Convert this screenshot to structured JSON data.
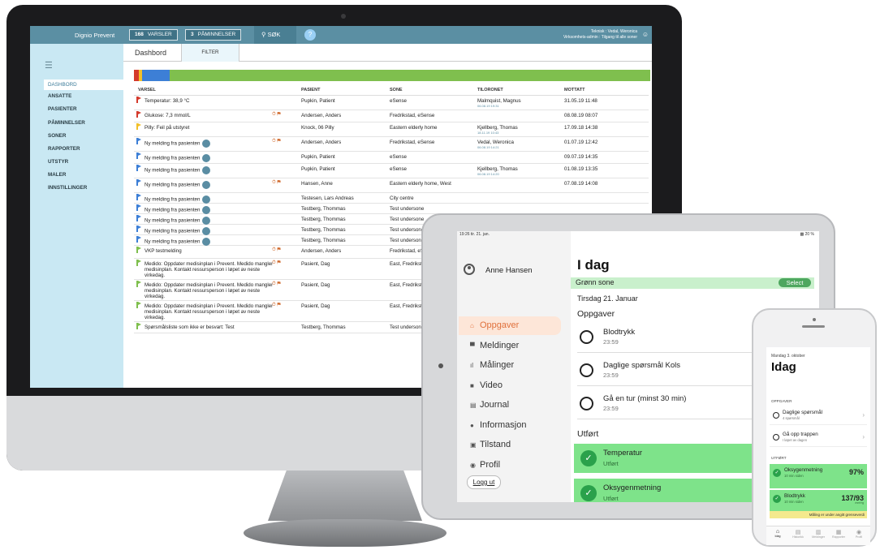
{
  "desktop": {
    "brand": "Dignio Prevent",
    "alerts_count": "168",
    "alerts_label": "VARSLER",
    "reminders_count": "3",
    "reminders_label": "PÅMINNELSER",
    "search_label": "SØK",
    "help_label": "?",
    "user_line1": "Teknisk : Vedal, Weronica",
    "user_line2": "Virksomhets-admin : Tilgang til alle soner",
    "tab_title": "Dashbord",
    "tab_filter": "FILTER",
    "sidebar": [
      {
        "label": "DASHBORD"
      },
      {
        "label": "ANSATTE"
      },
      {
        "label": "PASIENTER"
      },
      {
        "label": "PÅMINNELSER"
      },
      {
        "label": "SONER"
      },
      {
        "label": "RAPPORTER"
      },
      {
        "label": "UTSTYR"
      },
      {
        "label": "MALER"
      },
      {
        "label": "INNSTILLINGER"
      }
    ],
    "columns": [
      "VARSEL",
      "PASIENT",
      "SONE",
      "TILORONET",
      "MOTTATT"
    ],
    "rows": [
      {
        "varsel": "Temperatur: 38,9 °C",
        "pasient": "Pupkin, Patient",
        "sone": "eSense",
        "tildelt": "Malmquist, Magnus",
        "tildelt_sub": "06.08.19 19:31",
        "mottatt": "31.05.19 11:48"
      },
      {
        "varsel": "Glukose: 7,3 mmol/L",
        "pasient": "Andersen, Anders",
        "sone": "Fredrikstad, eSense",
        "tildelt": "",
        "tildelt_sub": "",
        "mottatt": "08.08.19 08:07"
      },
      {
        "varsel": "Pilly: Feil på utstyret",
        "pasient": "Knock, 06 Pilly",
        "sone": "Eastern elderly home",
        "tildelt": "Kjellberg, Thomas",
        "tildelt_sub": "18.11.19 10:43",
        "mottatt": "17.09.18 14:38"
      },
      {
        "varsel": "Ny melding fra pasienten",
        "pasient": "Andersen, Anders",
        "sone": "Fredrikstad, eSense",
        "tildelt": "Vedal, Weronica",
        "tildelt_sub": "06.08.19 14:21",
        "mottatt": "01.07.19 12:42"
      },
      {
        "varsel": "Ny melding fra pasienten",
        "pasient": "Pupkin, Patient",
        "sone": "eSense",
        "tildelt": "",
        "tildelt_sub": "",
        "mottatt": "09.07.19 14:35"
      },
      {
        "varsel": "Ny melding fra pasienten",
        "pasient": "Pupkin, Patient",
        "sone": "eSense",
        "tildelt": "Kjellberg, Thomas",
        "tildelt_sub": "06.08.19 14:20",
        "mottatt": "01.08.19 13:35"
      },
      {
        "varsel": "Ny melding fra pasienten",
        "pasient": "Hansen, Anne",
        "sone": "Eastern elderly home, West",
        "tildelt": "",
        "tildelt_sub": "",
        "mottatt": "07.08.19 14:08"
      },
      {
        "varsel": "Ny melding fra pasienten",
        "pasient": "Testesen, Lars Andreas",
        "sone": "City centre",
        "tildelt": "",
        "tildelt_sub": "",
        "mottatt": ""
      },
      {
        "varsel": "Ny melding fra pasienten",
        "pasient": "Testberg, Thommas",
        "sone": "Test undersone",
        "tildelt": "",
        "tildelt_sub": "",
        "mottatt": ""
      },
      {
        "varsel": "Ny melding fra pasienten",
        "pasient": "Testberg, Thommas",
        "sone": "Test undersone",
        "tildelt": "",
        "tildelt_sub": "",
        "mottatt": ""
      },
      {
        "varsel": "Ny melding fra pasienten",
        "pasient": "Testberg, Thommas",
        "sone": "Test undersone",
        "tildelt": "",
        "tildelt_sub": "",
        "mottatt": ""
      },
      {
        "varsel": "Ny melding fra pasienten",
        "pasient": "Testberg, Thommas",
        "sone": "Test undersone",
        "tildelt": "",
        "tildelt_sub": "",
        "mottatt": ""
      },
      {
        "varsel": "VKP testmelding",
        "pasient": "Andersen, Anders",
        "sone": "Fredrikstad, eSense",
        "tildelt": "",
        "tildelt_sub": "",
        "mottatt": ""
      },
      {
        "varsel": "Medido: Oppdater medisinplan i Prevent. Medido mangler medisinplan. Kontakt ressursperson i løpet av neste virkedag.",
        "pasient": "Pasient, Dag",
        "sone": "East, Fredrikstad",
        "tildelt": "",
        "tildelt_sub": "",
        "mottatt": ""
      },
      {
        "varsel": "Medido: Oppdater medisinplan i Prevent. Medido mangler medisinplan. Kontakt ressursperson i løpet av neste virkedag.",
        "pasient": "Pasient, Dag",
        "sone": "East, Fredrikstad",
        "tildelt": "",
        "tildelt_sub": "",
        "mottatt": ""
      },
      {
        "varsel": "Medido: Oppdater medisinplan i Prevent. Medido mangler medisinplan. Kontakt ressursperson i løpet av neste virkedag.",
        "pasient": "Pasient, Dag",
        "sone": "East, Fredrikstad",
        "tildelt": "",
        "tildelt_sub": "",
        "mottatt": ""
      },
      {
        "varsel": "Spørsmålsliste som ikke er besvart: Test",
        "pasient": "Testberg, Thommas",
        "sone": "Test undersone",
        "tildelt": "",
        "tildelt_sub": "",
        "mottatt": ""
      }
    ],
    "colors": {
      "red": "#d43a2c",
      "blue": "#3d7fd6",
      "yellow": "#f2c029",
      "green": "#7fbf4e"
    }
  },
  "tablet": {
    "status_left": "19:26  tir. 21. jan.",
    "status_right": "20 %",
    "user_name": "Anne Hansen",
    "nav": [
      {
        "label": "Oppgaver",
        "icon": "home-icon",
        "glyph": "⌂"
      },
      {
        "label": "Meldinger",
        "icon": "chat-icon",
        "glyph": "▀"
      },
      {
        "label": "Målinger",
        "icon": "bars-icon",
        "glyph": "ıl"
      },
      {
        "label": "Video",
        "icon": "video-icon",
        "glyph": "■"
      },
      {
        "label": "Journal",
        "icon": "journal-icon",
        "glyph": "▤"
      },
      {
        "label": "Informasjon",
        "icon": "info-icon",
        "glyph": "●"
      },
      {
        "label": "Tilstand",
        "icon": "state-icon",
        "glyph": "▣"
      },
      {
        "label": "Profil",
        "icon": "profile-icon",
        "glyph": "◉"
      }
    ],
    "logout": "Logg ut",
    "title": "I dag",
    "zone": "Grønn sone",
    "select": "Select",
    "date": "Tirsdag 21. Januar",
    "tasks_heading": "Oppgaver",
    "tasks": [
      {
        "title": "Blodtrykk",
        "time": "23:59"
      },
      {
        "title": "Daglige spørsmål Kols",
        "time": "23:59"
      },
      {
        "title": "Gå en tur (minst 30 min)",
        "time": "23:59"
      }
    ],
    "done_heading": "Utført",
    "done": [
      {
        "title": "Temperatur",
        "status": "Utført"
      },
      {
        "title": "Oksygenmetning",
        "status": "Utført"
      }
    ]
  },
  "phone": {
    "date": "Mandag 3. oktober",
    "title": "Idag",
    "tasks_heading": "OPPGAVER",
    "tasks": [
      {
        "title": "Daglige spørsmål",
        "sub": "4 spørsmål"
      },
      {
        "title": "Gå opp trappen",
        "sub": "I løpet av dagen"
      }
    ],
    "done_heading": "UTFØRT",
    "done": [
      {
        "title": "Oksygenmetning",
        "sub": "10 min siden",
        "value": "97%",
        "unit": ""
      },
      {
        "title": "Blodtrykk",
        "sub": "10 min siden",
        "value": "137/93",
        "unit": "mmHg"
      }
    ],
    "warning": "Måling er under angitt grenseverdi",
    "tabs": [
      {
        "label": "Idag"
      },
      {
        "label": "Historikk"
      },
      {
        "label": "Meldinger"
      },
      {
        "label": "Rapporter"
      },
      {
        "label": "Profil"
      }
    ]
  }
}
